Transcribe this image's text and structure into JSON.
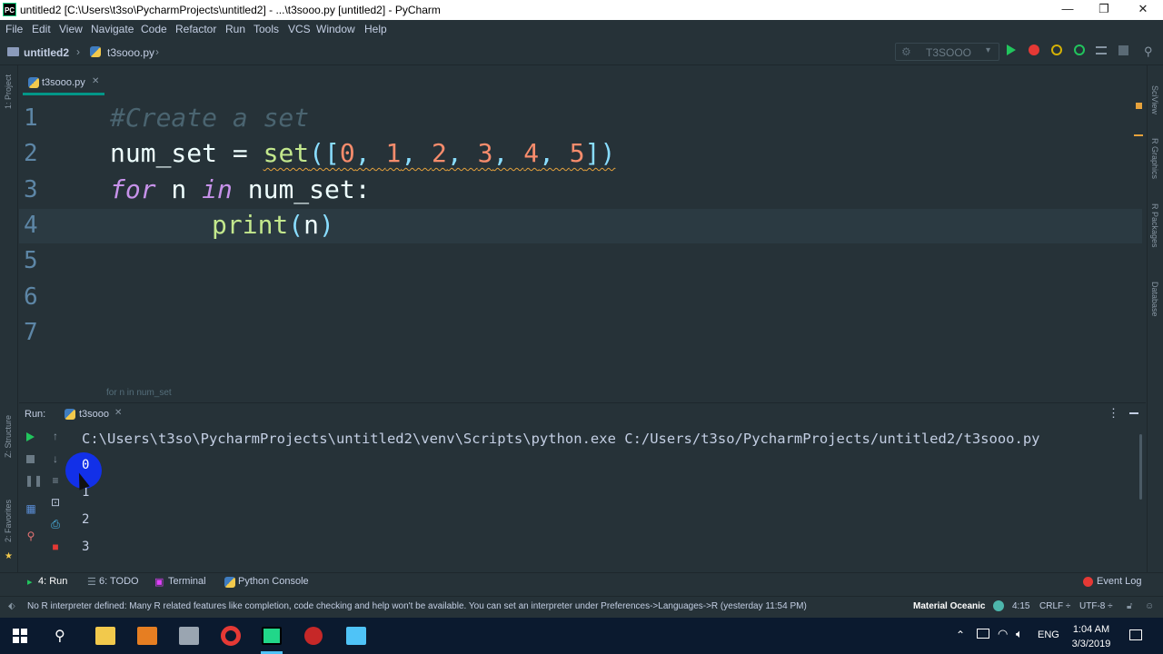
{
  "window": {
    "logo": "PC",
    "title": "untitled2 [C:\\Users\\t3so\\PycharmProjects\\untitled2] - ...\\t3sooo.py [untitled2] - PyCharm",
    "minimize": "—",
    "restore": "❐",
    "close": "✕"
  },
  "menu": [
    "File",
    "Edit",
    "View",
    "Navigate",
    "Code",
    "Refactor",
    "Run",
    "Tools",
    "VCS",
    "Window",
    "Help"
  ],
  "nav": {
    "project": "untitled2",
    "file": "t3sooo.py",
    "run_config": "T3SOOO"
  },
  "left_strip": {
    "project": "1: Project",
    "structure": "Z: Structure",
    "favorites": "2: Favorites"
  },
  "right_strip": {
    "sciview": "SciView",
    "rgraphics": "R Graphics",
    "rpackages": "R Packages",
    "database": "Database"
  },
  "tab": {
    "label": "t3sooo.py",
    "close": "✕"
  },
  "editor": {
    "line_numbers": [
      "1",
      "2",
      "3",
      "4",
      "5",
      "6",
      "7"
    ],
    "line1": "#Create a set",
    "line2": {
      "var": "num_set",
      "eq": " = ",
      "func": "set",
      "open": "([",
      "n0": "0",
      "n1": "1",
      "n2": "2",
      "n3": "3",
      "n4": "4",
      "n5": "5",
      "comma": ", ",
      "close": "])"
    },
    "line3": {
      "kw_for": "for",
      "n": " n ",
      "kw_in": "in",
      "rest": " num_set:"
    },
    "line4": {
      "func": "print",
      "open": "(",
      "arg": "n",
      "close": ")"
    },
    "hint": "for n in num_set"
  },
  "run_panel": {
    "label": "Run:",
    "tab": "t3sooo",
    "tab_close": "✕",
    "command": "C:\\Users\\t3so\\PycharmProjects\\untitled2\\venv\\Scripts\\python.exe C:/Users/t3so/PycharmProjects/untitled2/t3sooo.py",
    "output": [
      "0",
      "1",
      "2",
      "3"
    ]
  },
  "tool_tabs": {
    "run": "4: Run",
    "todo": "6: TODO",
    "terminal": "Terminal",
    "python_console": "Python Console",
    "event_log": "Event Log"
  },
  "status": {
    "message": "No R interpreter defined: Many R related features like completion, code checking and help won't be available. You can set an interpreter under Preferences->Languages->R (yesterday 11:54 PM)",
    "theme": "Material Oceanic",
    "position": "4:15",
    "line_sep": "CRLF ÷",
    "encoding": "UTF-8 ÷"
  },
  "taskbar": {
    "lang": "ENG",
    "time": "1:04 AM",
    "date": "3/3/2019"
  },
  "colors": {
    "accent": "#009688",
    "bg": "#263238",
    "keyword": "#c792ea",
    "function": "#c3e88d",
    "number": "#f78c6c"
  }
}
